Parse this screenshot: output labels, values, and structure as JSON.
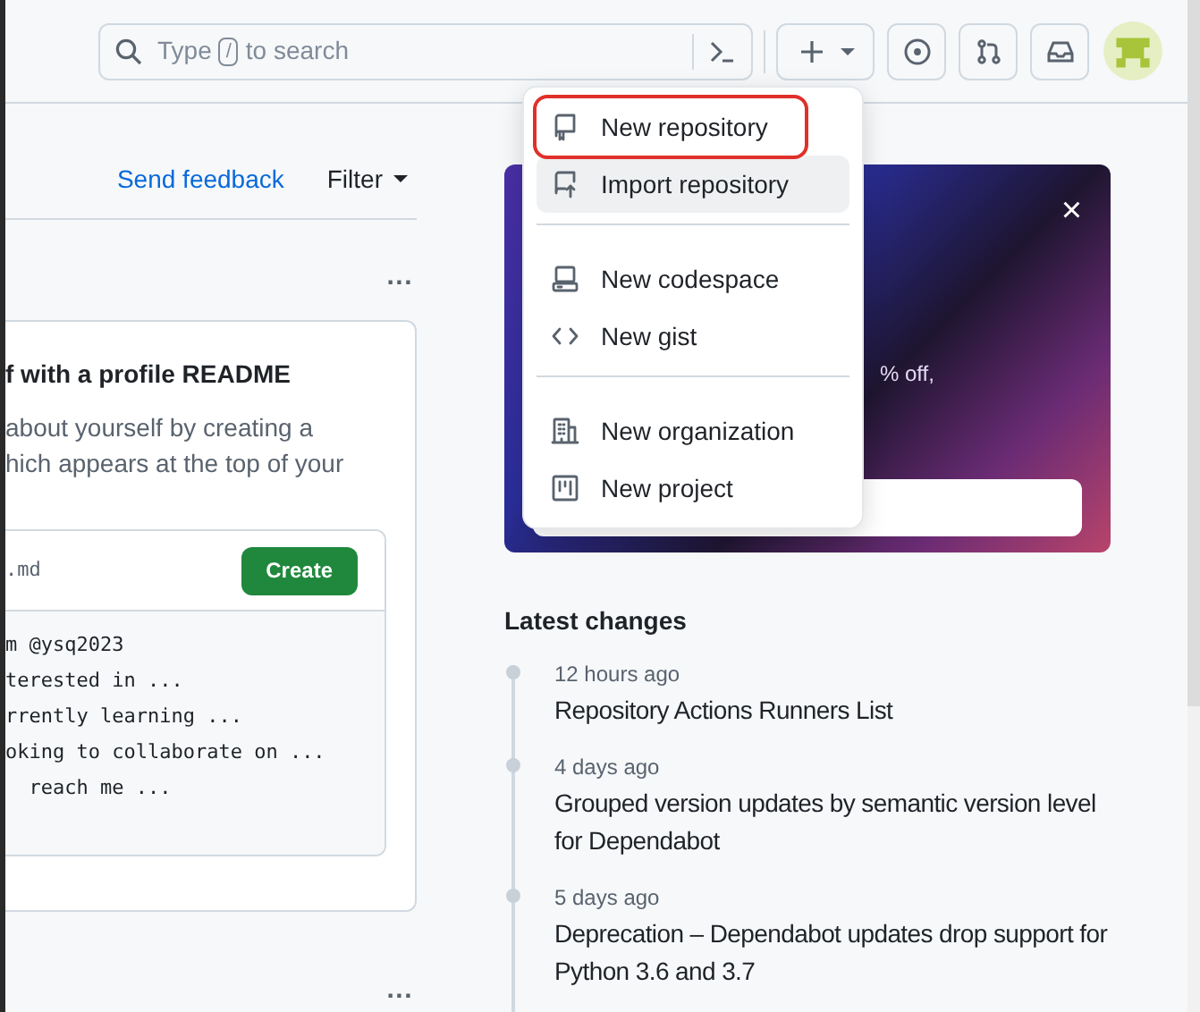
{
  "header": {
    "search": {
      "placeholder_before": "Type",
      "key": "/",
      "placeholder_after": "to search"
    },
    "buttons": [
      {
        "kind": "issues"
      },
      {
        "kind": "pull-requests"
      },
      {
        "kind": "inbox"
      }
    ]
  },
  "feed": {
    "send_feedback": "Send feedback",
    "filter": "Filter",
    "more": "...",
    "readme_card": {
      "title": "f with a profile README",
      "description": [
        "about yourself by creating a",
        "hich appears at the top of your"
      ],
      "file": ".md",
      "create": "Create",
      "code": [
        "m @ysq2023",
        "terested in ...",
        "rrently learning ...",
        "oking to collaborate on ...",
        "  reach me ..."
      ]
    },
    "more_bottom": "..."
  },
  "promo": {
    "text": "% off,",
    "close": "×"
  },
  "latest_changes": {
    "title": "Latest changes",
    "items": [
      {
        "time": "12 hours ago",
        "title": "Repository Actions Runners List"
      },
      {
        "time": "4 days ago",
        "title": "Grouped version updates by semantic version level for Dependabot"
      },
      {
        "time": "5 days ago",
        "title": "Deprecation – Dependabot updates drop support for Python 3.6 and 3.7"
      }
    ]
  },
  "create_menu": {
    "groups": [
      [
        {
          "kind": "repo",
          "label": "New repository",
          "annotated": true,
          "hovered": false
        },
        {
          "kind": "import",
          "label": "Import repository",
          "annotated": false,
          "hovered": true
        }
      ],
      [
        {
          "kind": "codespace",
          "label": "New codespace",
          "annotated": false,
          "hovered": false
        },
        {
          "kind": "gist",
          "label": "New gist",
          "annotated": false,
          "hovered": false
        }
      ],
      [
        {
          "kind": "organization",
          "label": "New organization",
          "annotated": false,
          "hovered": false
        },
        {
          "kind": "project",
          "label": "New project",
          "annotated": false,
          "hovered": false
        }
      ]
    ]
  }
}
